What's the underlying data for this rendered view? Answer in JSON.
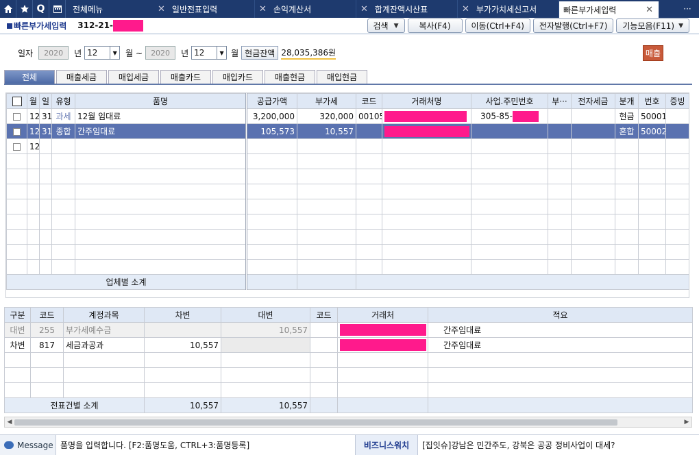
{
  "tabs": [
    {
      "label": "전체메뉴"
    },
    {
      "label": "일반전표입력"
    },
    {
      "label": "손익계산서"
    },
    {
      "label": "합계잔액시산표"
    },
    {
      "label": "부가가치세신고서"
    },
    {
      "label": "빠른부가세입력"
    }
  ],
  "title": {
    "label": "빠른부가세입력",
    "code_prefix": "312-21-"
  },
  "toolbar": {
    "search": "검색",
    "copy": "복사(F4)",
    "move": "이동(Ctrl+F4)",
    "einvoice": "전자발행(Ctrl+F7)",
    "functions": "기능모음(F11)"
  },
  "filter": {
    "date_label": "일자",
    "from_year": "2020",
    "year_unit": "년",
    "from_month": "12",
    "month_unit": "월 ~",
    "to_year": "2020",
    "to_month": "12",
    "month_unit2": "월",
    "cash_label": "현금잔액",
    "cash_value": "28,035,386원",
    "sale_badge": "매출"
  },
  "subtabs": [
    "전체",
    "매출세금",
    "매입세금",
    "매출카드",
    "매입카드",
    "매출현금",
    "매입현금"
  ],
  "upper": {
    "headers": [
      "월",
      "일",
      "유형",
      "품명",
      "공급가액",
      "부가세",
      "코드",
      "거래처명",
      "사업.주민번호",
      "부···",
      "전자세금",
      "분개",
      "번호",
      "증빙"
    ],
    "rows": [
      {
        "month": "12",
        "day": "31",
        "type": "과세",
        "item": "12월 임대료",
        "supply": "3,200,000",
        "vat": "320,000",
        "code": "00105",
        "partner": "",
        "bizno": "305-85-",
        "etc": "",
        "etax": "",
        "journal": "현금",
        "no": "50001",
        "proof": ""
      },
      {
        "month": "12",
        "day": "31",
        "type": "종합",
        "item": "간주임대료",
        "supply": "105,573",
        "vat": "10,557",
        "code": "",
        "partner": "",
        "bizno": "",
        "etc": "",
        "etax": "",
        "journal": "혼합",
        "no": "50002",
        "proof": ""
      },
      {
        "month": "12",
        "day": "",
        "type": "",
        "item": "",
        "supply": "",
        "vat": "",
        "code": "",
        "partner": "",
        "bizno": "",
        "etc": "",
        "etax": "",
        "journal": "",
        "no": "",
        "proof": ""
      }
    ],
    "subtotal_label": "업체별 소계"
  },
  "lower": {
    "headers": [
      "구분",
      "코드",
      "계정과목",
      "차변",
      "대변",
      "코드",
      "거래처",
      "적요"
    ],
    "rows": [
      {
        "kind": "대변",
        "code": "255",
        "account": "부가세예수금",
        "debit": "",
        "credit": "10,557",
        "pcode": "",
        "partner": "",
        "memo": "간주임대료"
      },
      {
        "kind": "차변",
        "code": "817",
        "account": "세금과공과",
        "debit": "10,557",
        "credit": "",
        "pcode": "",
        "partner": "",
        "memo": "간주임대료"
      }
    ],
    "subtotal_label": "전표건별 소계",
    "subtotal_debit": "10,557",
    "subtotal_credit": "10,557"
  },
  "status": {
    "message_tab": "Message",
    "message": "품명을 입력합니다. [F2:품명도움, CTRL+3:품명등록]",
    "biz_watch": "비즈니스워치",
    "news": "[집잇슈]강남은 민간주도, 강북은 공공 정비사업이 대세?"
  },
  "icons": [
    "home-icon",
    "star-icon",
    "search-icon",
    "calendar-icon",
    "close-icon",
    "more-icon",
    "chevron-down-icon"
  ],
  "colors": {
    "topbar": "#1e3a6e",
    "selected_row": "#5a72b0",
    "redaction": "#ff1a8c",
    "sale_badge": "#c85a3a"
  }
}
